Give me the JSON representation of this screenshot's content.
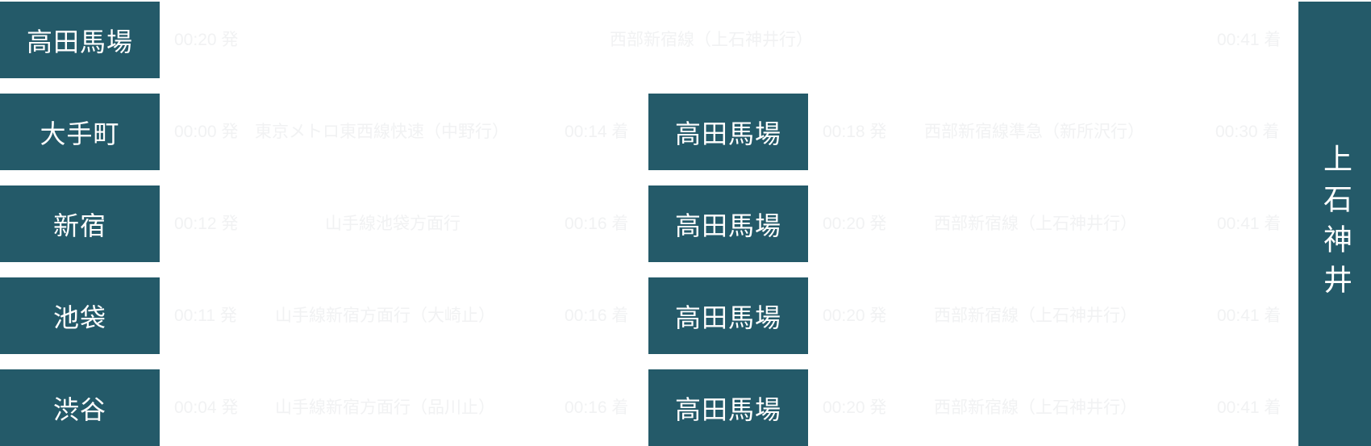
{
  "destination": "上石神井",
  "routes": [
    {
      "origin": "高田馬場",
      "legs": [
        {
          "depart": "00:20 発",
          "line": "西部新宿線（上石神井行）",
          "arrive": "00:41 着"
        }
      ]
    },
    {
      "origin": "大手町",
      "legs": [
        {
          "depart": "00:00 発",
          "line": "東京メトロ東西線快速（中野行）",
          "arrive": "00:14 着"
        },
        {
          "transfer": "高田馬場",
          "depart": "00:18 発",
          "line": "西部新宿線準急（新所沢行）",
          "arrive": "00:30 着"
        }
      ]
    },
    {
      "origin": "新宿",
      "legs": [
        {
          "depart": "00:12 発",
          "line": "山手線池袋方面行",
          "arrive": "00:16 着"
        },
        {
          "transfer": "高田馬場",
          "depart": "00:20 発",
          "line": "西部新宿線（上石神井行）",
          "arrive": "00:41 着"
        }
      ]
    },
    {
      "origin": "池袋",
      "legs": [
        {
          "depart": "00:11 発",
          "line": "山手線新宿方面行（大崎止）",
          "arrive": "00:16 着"
        },
        {
          "transfer": "高田馬場",
          "depart": "00:20 発",
          "line": "西部新宿線（上石神井行）",
          "arrive": "00:41 着"
        }
      ]
    },
    {
      "origin": "渋谷",
      "legs": [
        {
          "depart": "00:04 発",
          "line": "山手線新宿方面行（品川止）",
          "arrive": "00:16 着"
        },
        {
          "transfer": "高田馬場",
          "depart": "00:20 発",
          "line": "西部新宿線（上石神井行）",
          "arrive": "00:41 着"
        }
      ]
    }
  ]
}
